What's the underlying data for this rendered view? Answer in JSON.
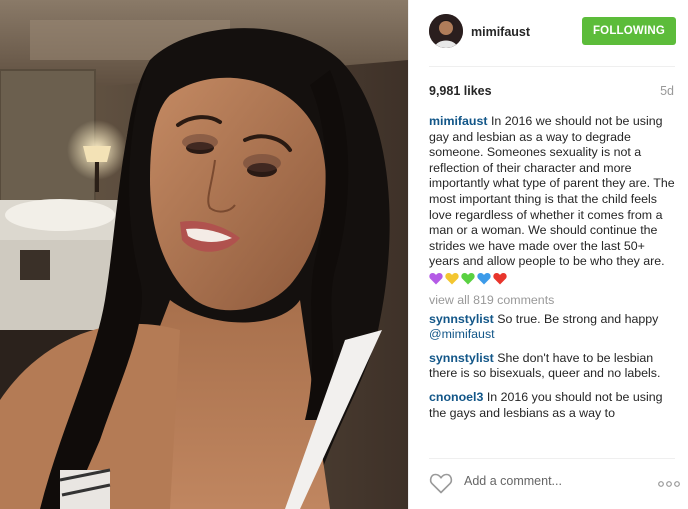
{
  "post": {
    "username": "mimifaust",
    "follow_label": "FOLLOWING",
    "likes": "9,981 likes",
    "age": "5d",
    "caption": {
      "username": "mimifaust",
      "text": "In 2016 we should not be using gay and lesbian as a way to degrade someone. Someones sexuality is not a reflection of their character and more importantly what type of parent they are. The most important thing is that the child feels love regardless of whether it comes from a man or a woman. We should continue the strides we have made over the last 50+ years and allow people to be who they are."
    },
    "emoji_colors": [
      "#b45be6",
      "#f3c631",
      "#5ad142",
      "#3d9be9",
      "#e8352c"
    ],
    "view_all": "view all 819 comments",
    "comments": [
      {
        "username": "synnstylist",
        "text": "So true. Be strong and happy ",
        "mention": "@mimifaust"
      },
      {
        "username": "synnstylist",
        "text": "She don't have to be lesbian there is so bisexuals, queer and no labels.",
        "mention": ""
      },
      {
        "username": "cnonoel3",
        "text": "In 2016 you should not be using the gays and lesbians as a way to",
        "mention": ""
      }
    ],
    "add_comment_placeholder": "Add a comment...",
    "icons": {
      "like": "heart-outline-icon",
      "more": "more-options-icon"
    },
    "colors": {
      "follow_green": "#5cbc3a",
      "link_blue": "#125688",
      "muted": "#999999"
    }
  }
}
